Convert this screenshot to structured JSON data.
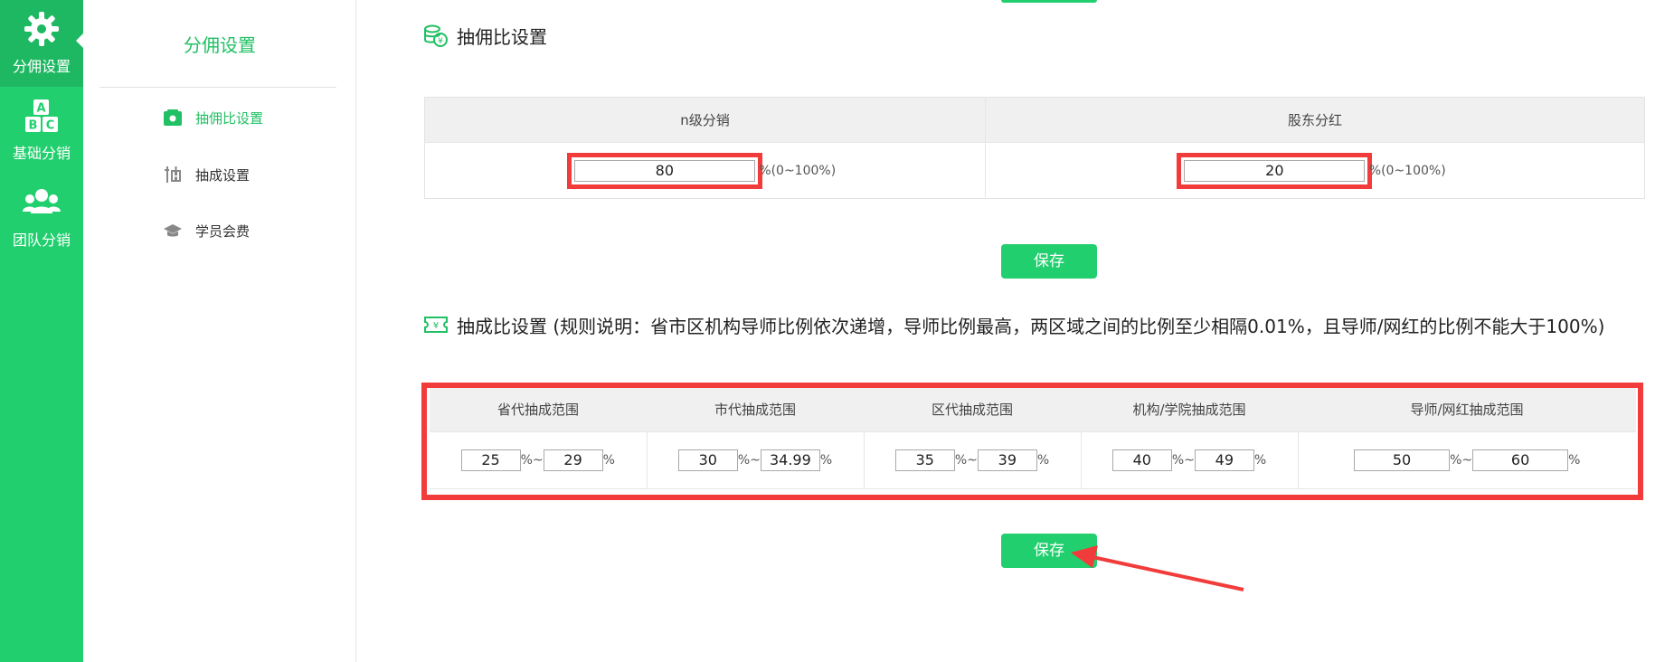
{
  "leftnav": {
    "items": [
      {
        "label": "分佣设置",
        "icon": "gear-icon"
      },
      {
        "label": "基础分销",
        "icon": "abc-blocks-icon"
      },
      {
        "label": "团队分销",
        "icon": "team-icon"
      }
    ]
  },
  "subnav": {
    "title": "分佣设置",
    "items": [
      {
        "label": "抽佣比设置",
        "icon": "wallet-icon"
      },
      {
        "label": "抽成设置",
        "icon": "chou-char-icon"
      },
      {
        "label": "学员会费",
        "icon": "graduation-cap-icon"
      }
    ]
  },
  "section1": {
    "title": "抽佣比设置",
    "columns": [
      "n级分销",
      "股东分红"
    ],
    "values": [
      "80",
      "20"
    ],
    "suffix": "%(0~100%)",
    "save_label": "保存"
  },
  "section2": {
    "title": "抽成比设置 (规则说明：省市区机构导师比例依次递增，导师比例最高，两区域之间的比例至少相隔0.01%，且导师/网红的比例不能大于100%)",
    "columns": [
      "省代抽成范围",
      "市代抽成范围",
      "区代抽成范围",
      "机构/学院抽成范围",
      "导师/网红抽成范围"
    ],
    "ranges": [
      {
        "min": "25",
        "max": "29"
      },
      {
        "min": "30",
        "max": "34.99"
      },
      {
        "min": "35",
        "max": "39"
      },
      {
        "min": "40",
        "max": "49"
      },
      {
        "min": "50",
        "max": "60"
      }
    ],
    "pct": "%",
    "tilde": "~",
    "save_label": "保存"
  },
  "colors": {
    "accent": "#22cf6e",
    "highlight": "#f23c3c"
  }
}
